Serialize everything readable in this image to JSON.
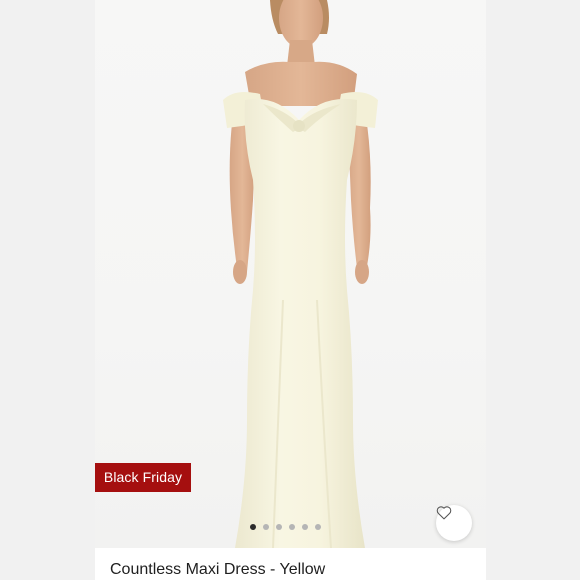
{
  "listing": {
    "badge_text": "Black Friday",
    "title": "Countless Maxi Dress - Yellow",
    "like_icon": "heart-outline-icon",
    "carousel": {
      "total_images": 6,
      "current_index": 0
    }
  },
  "colors": {
    "badge_background": "#a50f0f",
    "dress": "#f7f4df",
    "active_dot": "#2b2b2b",
    "inactive_dot": "#b5b5b5"
  }
}
